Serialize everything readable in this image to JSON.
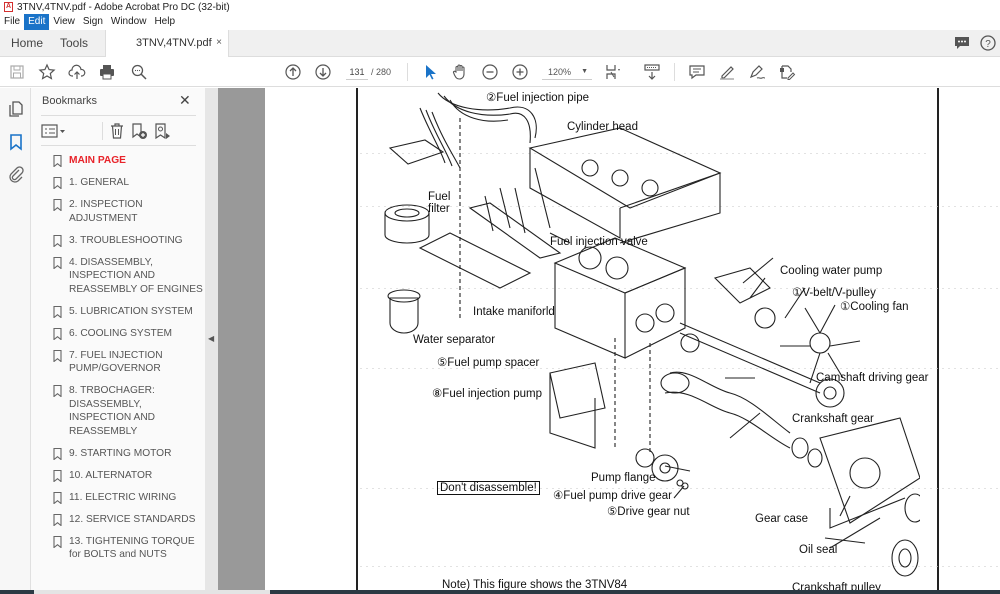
{
  "window": {
    "title": "3TNV,4TNV.pdf - Adobe Acrobat Pro DC (32-bit)",
    "menu": [
      "File",
      "Edit",
      "View",
      "Sign",
      "Window",
      "Help"
    ],
    "active_menu": "Edit"
  },
  "tabs": {
    "home": "Home",
    "tools": "Tools",
    "document": "3TNV,4TNV.pdf",
    "close": "×"
  },
  "toolbar": {
    "current_page": "131",
    "total_pages": "/ 280",
    "zoom": "120%",
    "icons": [
      "save-icon",
      "bookmark-star-icon",
      "upload-cloud-icon",
      "print-icon",
      "search-zoom-icon",
      "prev-page-icon",
      "next-page-icon",
      "select-cursor-icon",
      "hand-icon",
      "zoom-out-icon",
      "zoom-in-icon",
      "page-fit-icon",
      "scroll-mode-icon",
      "comment-icon",
      "highlight-pen-icon",
      "sign-icon",
      "fill-sign-icon"
    ]
  },
  "panel": {
    "title": "Bookmarks",
    "close": "✕",
    "bookmarks": [
      {
        "label": "MAIN PAGE",
        "highlight": true
      },
      {
        "label": "1. GENERAL"
      },
      {
        "label": "2. INSPECTION ADJUSTMENT"
      },
      {
        "label": "3. TROUBLESHOOTING"
      },
      {
        "label": "4. DISASSEMBLY, INSPECTION AND REASSEMBLY OF ENGINES"
      },
      {
        "label": "5. LUBRICATION SYSTEM"
      },
      {
        "label": "6. COOLING SYSTEM"
      },
      {
        "label": "7. FUEL INJECTION PUMP/GOVERNOR"
      },
      {
        "label": "8. TRBOCHAGER: DISASSEMBLY, INSPECTION AND REASSEMBLY"
      },
      {
        "label": "9. STARTING MOTOR"
      },
      {
        "label": "10. ALTERNATOR"
      },
      {
        "label": "11. ELECTRIC WIRING"
      },
      {
        "label": "12. SERVICE STANDARDS"
      },
      {
        "label": "13. TIGHTENING TORQUE for BOLTS and NUTS"
      }
    ]
  },
  "document": {
    "labels": {
      "fuel_injection_pipe": "②Fuel injection pipe",
      "cylinder_head": "Cylinder head",
      "fuel": "Fuel",
      "filter": "filter",
      "fuel_injection_valve": "Fuel injection valve",
      "cooling_water_pump": "Cooling water pump",
      "v_belt": "①V-belt/V-pulley",
      "cooling_fan": "①Cooling fan",
      "intake_manifold": "Intake maniforld",
      "water_separator": "Water separator",
      "fuel_pump_spacer": "⑤Fuel pump spacer",
      "camshaft_driving_gear": "Camshaft driving gear",
      "fuel_injection_pump": "⑧Fuel injection pump",
      "crankshaft_gear": "Crankshaft gear",
      "pump_flange": "Pump flange",
      "dont_disassemble": "Don't disassemble!",
      "fuel_pump_drive_gear": "④Fuel pump drive gear",
      "drive_gear_nut": "⑤Drive gear nut",
      "gear_case": "Gear case",
      "oil_seal": "Oil seal",
      "crankshaft_pulley": "Crankshaft pulley",
      "note": "Note) This figure shows the 3TNV84"
    }
  },
  "colors": {
    "accent_blue": "#1a73c8",
    "bookmark_highlight": "#e8232a",
    "doc_gutter": "#999999"
  }
}
